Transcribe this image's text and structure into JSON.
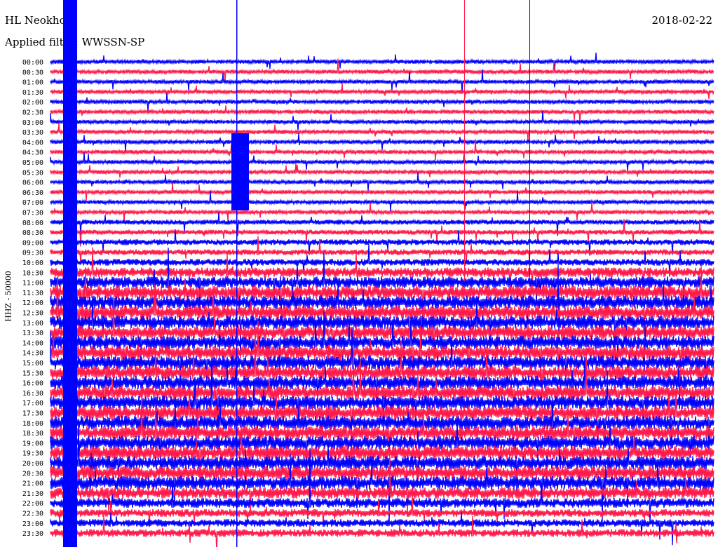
{
  "header": {
    "station": "HL Neokho",
    "date": "2018-02-22",
    "filter": "Applied filter: WWSSN-SP"
  },
  "chart_data": {
    "type": "line",
    "title": "HL Neokho",
    "subtitle": "Applied filter: WWSSN-SP",
    "date": "2018-02-22",
    "ylabel": "HHZ - 50000",
    "xlabel": "",
    "row_labels": [
      "00:00",
      "00:30",
      "01:00",
      "01:30",
      "02:00",
      "02:30",
      "03:00",
      "03:30",
      "04:00",
      "04:30",
      "05:00",
      "05:30",
      "06:00",
      "06:30",
      "07:00",
      "07:30",
      "08:00",
      "08:30",
      "09:00",
      "09:30",
      "10:00",
      "10:30",
      "11:00",
      "11:30",
      "12:00",
      "12:30",
      "13:00",
      "13:30",
      "14:00",
      "14:30",
      "15:00",
      "15:30",
      "16:00",
      "16:30",
      "17:00",
      "17:30",
      "18:00",
      "18:30",
      "19:00",
      "19:30",
      "20:00",
      "20:30",
      "21:00",
      "21:30",
      "22:00",
      "22:30",
      "23:00",
      "23:30"
    ],
    "series_colors": [
      "#0000ff",
      "#ff1a4a"
    ],
    "relative_noise_level": [
      2,
      2,
      2,
      2,
      2,
      2,
      2,
      2,
      2,
      2,
      2,
      2,
      2,
      2,
      2,
      2,
      2.5,
      2.5,
      3,
      3,
      3.5,
      5,
      6,
      7,
      7,
      7,
      7,
      7,
      7,
      7,
      7,
      7,
      7,
      7,
      7,
      7,
      7,
      7,
      7,
      7,
      7,
      7,
      7,
      6,
      5,
      4,
      4,
      4
    ],
    "grid": false
  }
}
